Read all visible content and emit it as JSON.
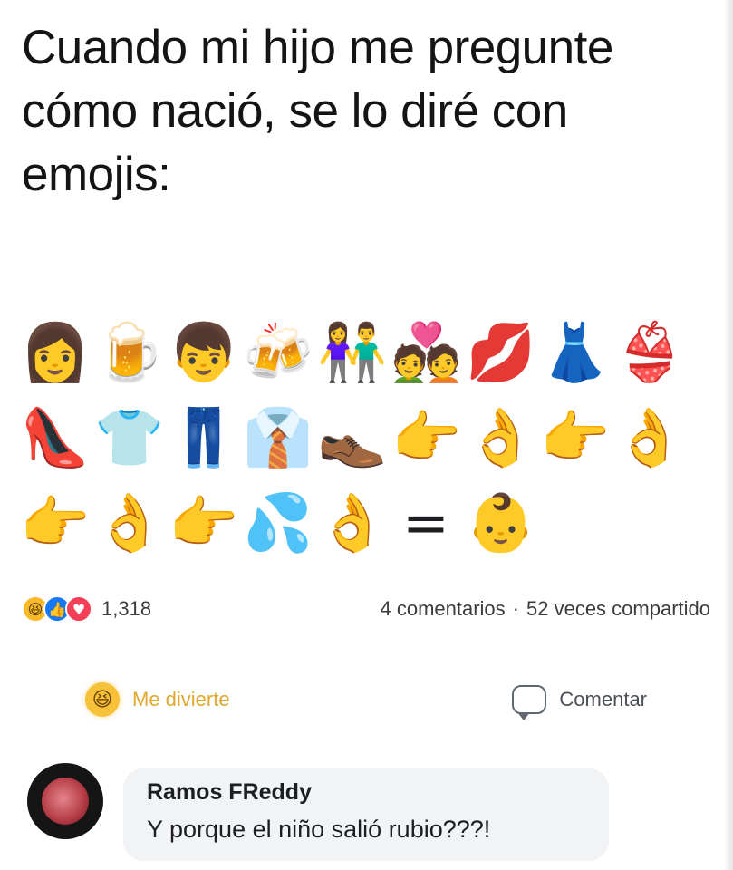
{
  "post": {
    "title": "Cuando mi hijo me pregunte cómo nació, se lo diré con emojis:"
  },
  "emoji_rows": [
    [
      {
        "char": "👩",
        "name": "woman-emoji"
      },
      {
        "char": "🍺",
        "name": "beer-mug-emoji"
      },
      {
        "char": "👦",
        "name": "boy-emoji"
      },
      {
        "char": "🍻",
        "name": "clinking-beers-emoji"
      },
      {
        "char": "👫",
        "name": "couple-emoji"
      },
      {
        "char": "💑",
        "name": "couple-with-heart-emoji"
      },
      {
        "char": "💋",
        "name": "kiss-lips-emoji"
      },
      {
        "char": "👗",
        "name": "dress-emoji"
      },
      {
        "char": "👙",
        "name": "bikini-emoji"
      }
    ],
    [
      {
        "char": "👠",
        "name": "high-heel-emoji"
      },
      {
        "char": "👕",
        "name": "tshirt-emoji"
      },
      {
        "char": "👖",
        "name": "jeans-emoji"
      },
      {
        "char": "👔",
        "name": "necktie-emoji"
      },
      {
        "char": "👞",
        "name": "shoes-emoji"
      },
      {
        "char": "👉",
        "name": "pointing-right-emoji"
      },
      {
        "char": "👌",
        "name": "ok-hand-emoji"
      },
      {
        "char": "👉",
        "name": "pointing-right-emoji"
      },
      {
        "char": "👌",
        "name": "ok-hand-emoji"
      }
    ],
    [
      {
        "char": "👉",
        "name": "pointing-right-emoji"
      },
      {
        "char": "👌",
        "name": "ok-hand-emoji"
      },
      {
        "char": "👉",
        "name": "pointing-right-emoji"
      },
      {
        "char": "💦",
        "name": "sweat-droplets-emoji"
      },
      {
        "char": "👌",
        "name": "ok-hand-emoji"
      },
      {
        "char": "=",
        "name": "equals-sign"
      },
      {
        "char": "👶",
        "name": "blond-baby-emoji"
      }
    ]
  ],
  "reactions": {
    "icons": [
      {
        "name": "haha-reaction-icon",
        "glyph": "😆"
      },
      {
        "name": "like-reaction-icon",
        "glyph": "👍"
      },
      {
        "name": "love-reaction-icon",
        "glyph": "♥"
      }
    ],
    "count": "1,318",
    "comments": "4 comentarios",
    "separator": "·",
    "shares": "52 veces compartido"
  },
  "actions": {
    "haha_icon": "😆",
    "haha_label": "Me divierte",
    "comment_label": "Comentar"
  },
  "comment": {
    "author": "Ramos FReddy",
    "text": "Y porque el niño salió rubio???!"
  },
  "colors": {
    "haha": "#f7c13a",
    "like": "#1877f2",
    "love": "#f33e58",
    "bubble": "#f2f3f5"
  }
}
